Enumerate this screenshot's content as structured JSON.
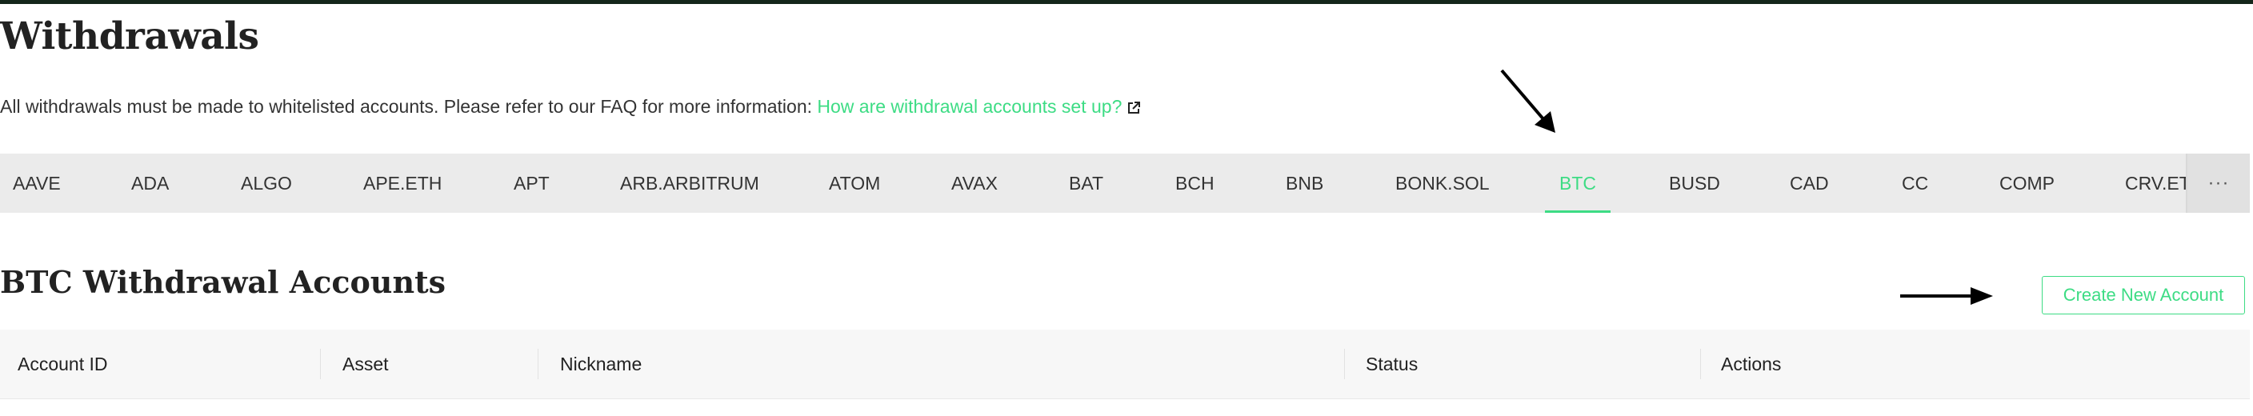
{
  "page": {
    "title": "Withdrawals",
    "info_text": "All withdrawals must be made to whitelisted accounts. Please refer to our FAQ for more information: ",
    "info_link": "How are withdrawal accounts set up?",
    "accent_color": "#3ddc84"
  },
  "tabs": [
    {
      "label": "AAVE"
    },
    {
      "label": "ADA"
    },
    {
      "label": "ALGO"
    },
    {
      "label": "APE.ETH"
    },
    {
      "label": "APT"
    },
    {
      "label": "ARB.ARBITRUM"
    },
    {
      "label": "ATOM"
    },
    {
      "label": "AVAX"
    },
    {
      "label": "BAT"
    },
    {
      "label": "BCH"
    },
    {
      "label": "BNB"
    },
    {
      "label": "BONK.SOL"
    },
    {
      "label": "BTC",
      "active": true
    },
    {
      "label": "BUSD"
    },
    {
      "label": "CAD"
    },
    {
      "label": "CC"
    },
    {
      "label": "COMP"
    },
    {
      "label": "CRV.ET"
    }
  ],
  "more_tabs_label": "···",
  "section": {
    "title": "BTC Withdrawal Accounts",
    "create_button": "Create New Account"
  },
  "table": {
    "columns": [
      "Account ID",
      "Asset",
      "Nickname",
      "Status",
      "Actions"
    ]
  },
  "icons": {
    "external_link": "external-link-icon",
    "arrows": [
      "arrow-pointer-icon",
      "arrow-pointer-icon"
    ]
  }
}
